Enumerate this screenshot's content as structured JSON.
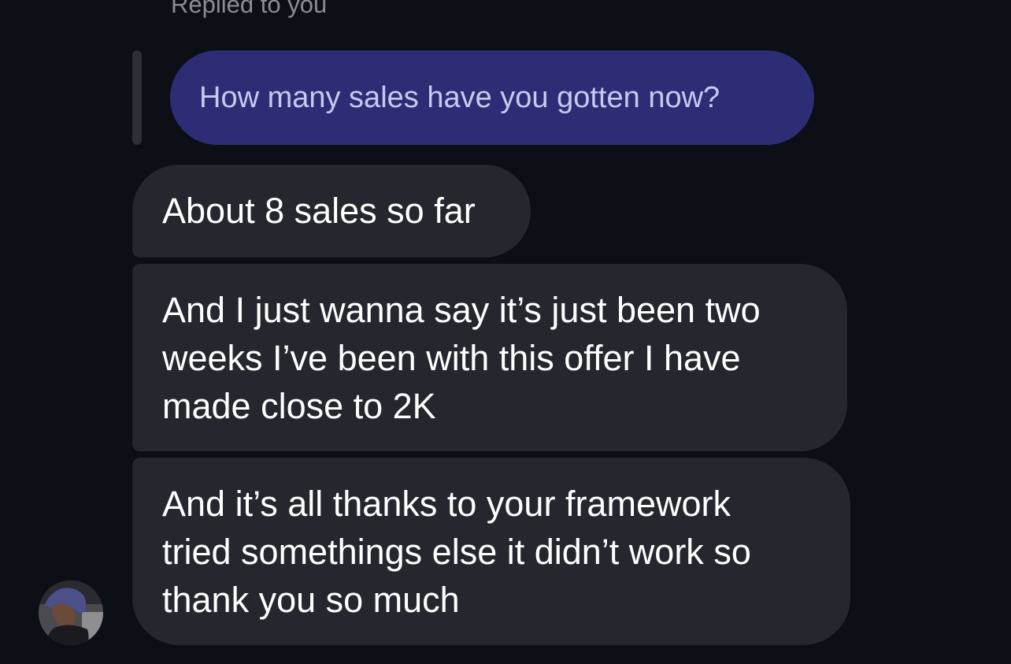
{
  "thread": {
    "reply_context": "Replied to you",
    "quoted_message": "How many sales have you gotten now?",
    "messages": [
      {
        "lines": [
          "About 8 sales so far"
        ]
      },
      {
        "lines": [
          "And I just wanna say it’s just been two",
          "weeks I’ve been with this offer I have",
          "made close to 2K"
        ]
      },
      {
        "lines": [
          "And it’s all thanks to your framework",
          "tried somethings else it didn’t work so",
          "thank you so much"
        ]
      }
    ]
  },
  "avatar": {
    "icon": "user-avatar"
  },
  "colors": {
    "background": "#0c0f15",
    "incoming_bubble": "#24272e",
    "quoted_bubble": "#2c2d75",
    "quoted_text": "#c8c9f0",
    "secondary_text": "#8a8d94"
  }
}
